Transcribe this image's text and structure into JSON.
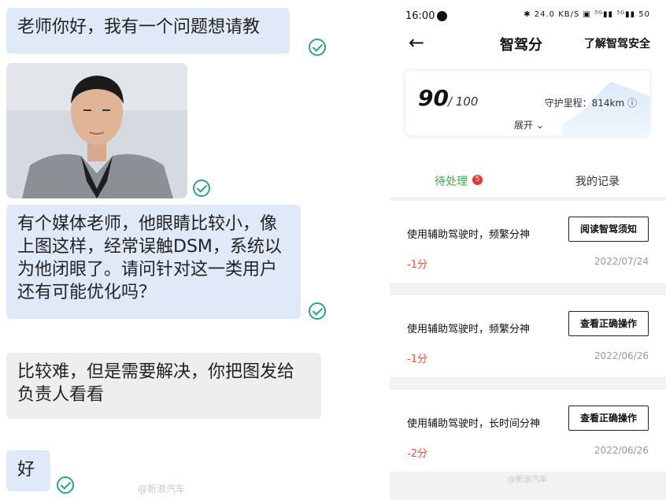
{
  "chat": {
    "messages": [
      {
        "text": "老师你好，我有一个问题想请教"
      },
      {
        "text": "有个媒体老师，他眼睛比较小，像上图这样，经常误触DSM，系统以为他闭眼了。请问针对这一类用户还有可能优化吗？"
      },
      {
        "text": "比较难，但是需要解决，你把图发给负责人看看"
      },
      {
        "text": "好"
      }
    ],
    "watermark": "@新浪汽车"
  },
  "phone": {
    "status": {
      "time": "16:00",
      "icons": "✱ 24.0 KB/S ▣ ⁵ᴳ▮▮ ⁵ᴳ▮▮ 50"
    },
    "nav": {
      "back": "←",
      "title": "智驾分",
      "link": "了解智驾安全"
    },
    "score": {
      "value": "90",
      "max": "/ 100",
      "mileage": "守护里程：814km ⓘ",
      "expand": "展开 ⌄"
    },
    "tabs": {
      "pending": "待处理",
      "badge": "5",
      "records": "我的记录"
    },
    "records": [
      {
        "title": "使用辅助驾驶时，频繁分神",
        "button": "阅读智驾须知",
        "points": "-1分",
        "date": "2022/07/24"
      },
      {
        "title": "使用辅助驾驶时，频繁分神",
        "button": "查看正确操作",
        "points": "-1分",
        "date": "2022/06/26"
      },
      {
        "title": "使用辅助驾驶时，长时间分神",
        "button": "查看正确操作",
        "points": "-2分",
        "date": "2022/06/26"
      }
    ],
    "watermark": "@新浪汽车"
  },
  "colors": {
    "accent_green": "#3fab4f",
    "penalty_red": "#e8533a",
    "chat_blue": "#dfe9f7",
    "check_green": "#2fa57c"
  }
}
